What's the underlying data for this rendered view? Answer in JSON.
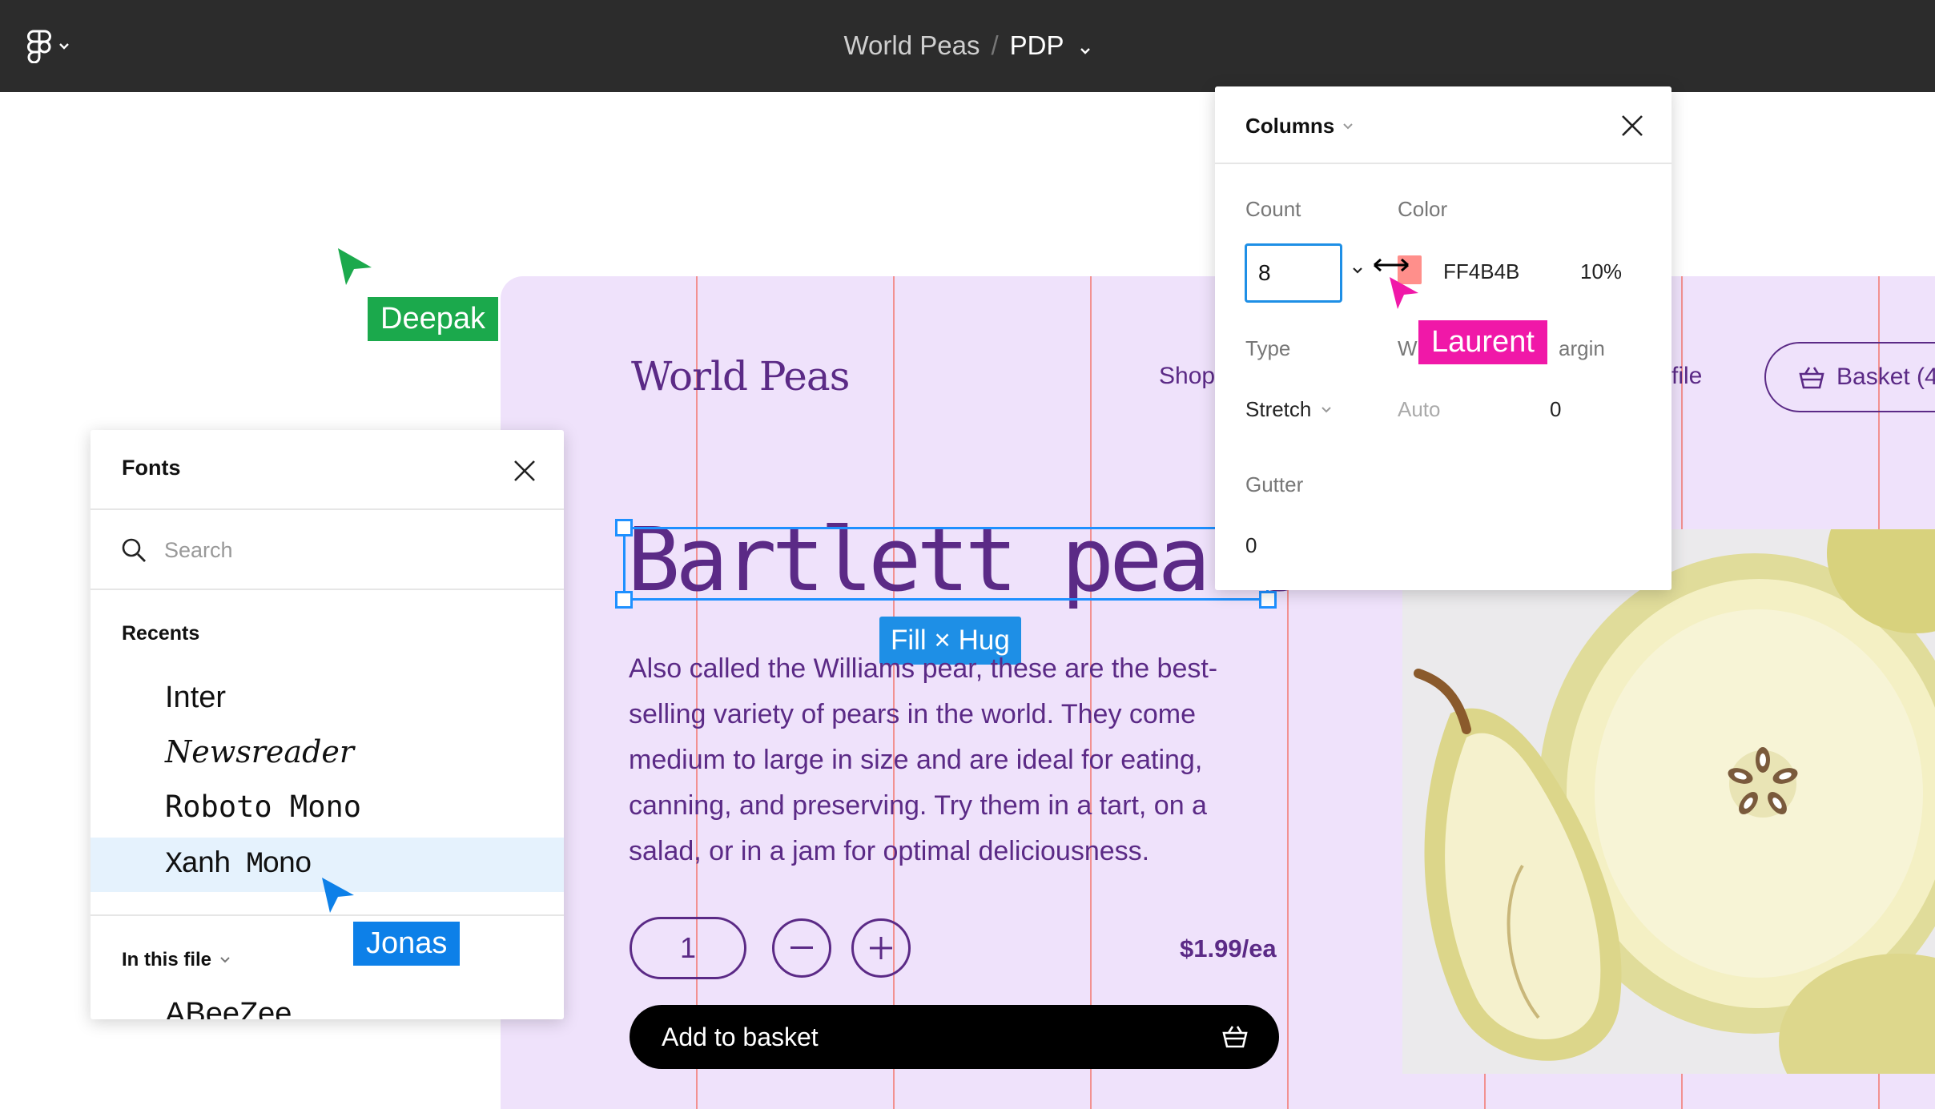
{
  "topbar": {
    "file_name": "World Peas",
    "separator": "/",
    "page_name": "PDP"
  },
  "site": {
    "brand": "World Peas",
    "nav_shop": "Shop",
    "nav_profile_partial": "file",
    "basket_label": "Basket (4",
    "headline": "Bartlett pears",
    "size_tag": "Fill × Hug",
    "description": "Also called the Williams pear, these are the best-selling variety of pears in the world. They come medium to large in size and are ideal for eating, canning, and preserving. Try them in a tart, on a salad, or in a jam for optimal deliciousness.",
    "quantity": "1",
    "price": "$1.99/ea",
    "add_to_basket": "Add to basket"
  },
  "fonts_panel": {
    "title": "Fonts",
    "search_placeholder": "Search",
    "recents_heading": "Recents",
    "recents": [
      {
        "name": "Inter"
      },
      {
        "name": "Newsreader"
      },
      {
        "name": "Roboto Mono"
      },
      {
        "name": "Xanh Mono"
      }
    ],
    "selected_font": "Xanh Mono",
    "in_this_file_label": "In this file",
    "partial_font": "ABeeZee"
  },
  "columns_panel": {
    "title": "Columns",
    "count_label": "Count",
    "count_value": "8",
    "color_label": "Color",
    "color_hex": "FF4B4B",
    "opacity": "10%",
    "type_label": "Type",
    "type_value": "Stretch",
    "width_label_partial": "W",
    "width_value": "Auto",
    "margin_label_partial": "argin",
    "margin_value": "0",
    "gutter_label": "Gutter",
    "gutter_value": "0"
  },
  "collaborators": [
    {
      "name": "Deepak",
      "color": "#1ba94c"
    },
    {
      "name": "Laurent",
      "color": "#f018a8"
    },
    {
      "name": "Jonas",
      "color": "#0d80e8"
    }
  ],
  "colors": {
    "topbar": "#2c2c2c",
    "frame_bg": "#efe2fb",
    "brand_purple": "#5b2a86",
    "grid_line": "#f2827e",
    "selection_blue": "#1e90ff"
  },
  "icons": [
    "figma-logo-icon",
    "chevron-down-icon",
    "search-icon",
    "close-icon",
    "basket-icon",
    "minus-icon",
    "plus-icon",
    "resize-cursor-icon"
  ]
}
